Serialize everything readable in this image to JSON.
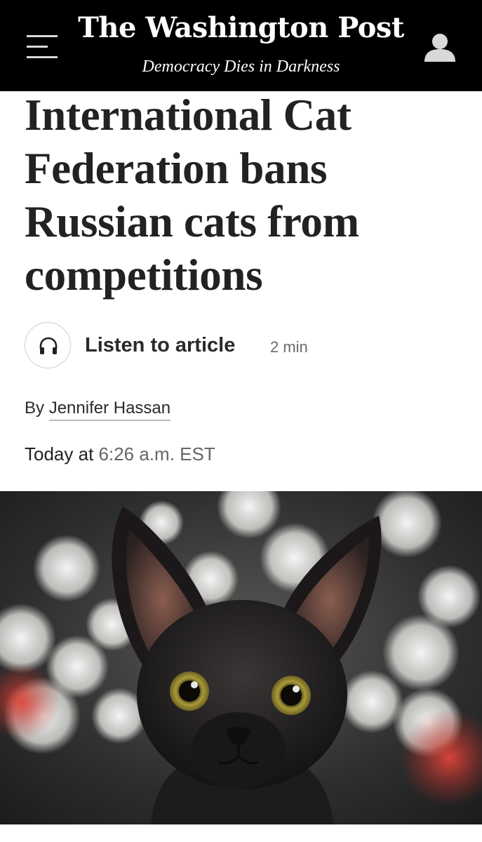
{
  "header": {
    "masthead": "The Washington Post",
    "tagline": "Democracy Dies in Darkness",
    "menu_icon": "hamburger-menu-icon",
    "account_icon": "user-account-icon",
    "background": "#000000"
  },
  "article": {
    "headline": "International Cat Federation bans Russian cats from competitions",
    "listen": {
      "icon": "headphones-icon",
      "label": "Listen to article",
      "duration": "2 min"
    },
    "byline_prefix": "By",
    "author": "Jennifer Hassan",
    "date_prefix": "Today at",
    "time": "6:26 a.m. EST"
  },
  "hero_image": {
    "description_icon": "hairless-black-kitten-photo"
  }
}
